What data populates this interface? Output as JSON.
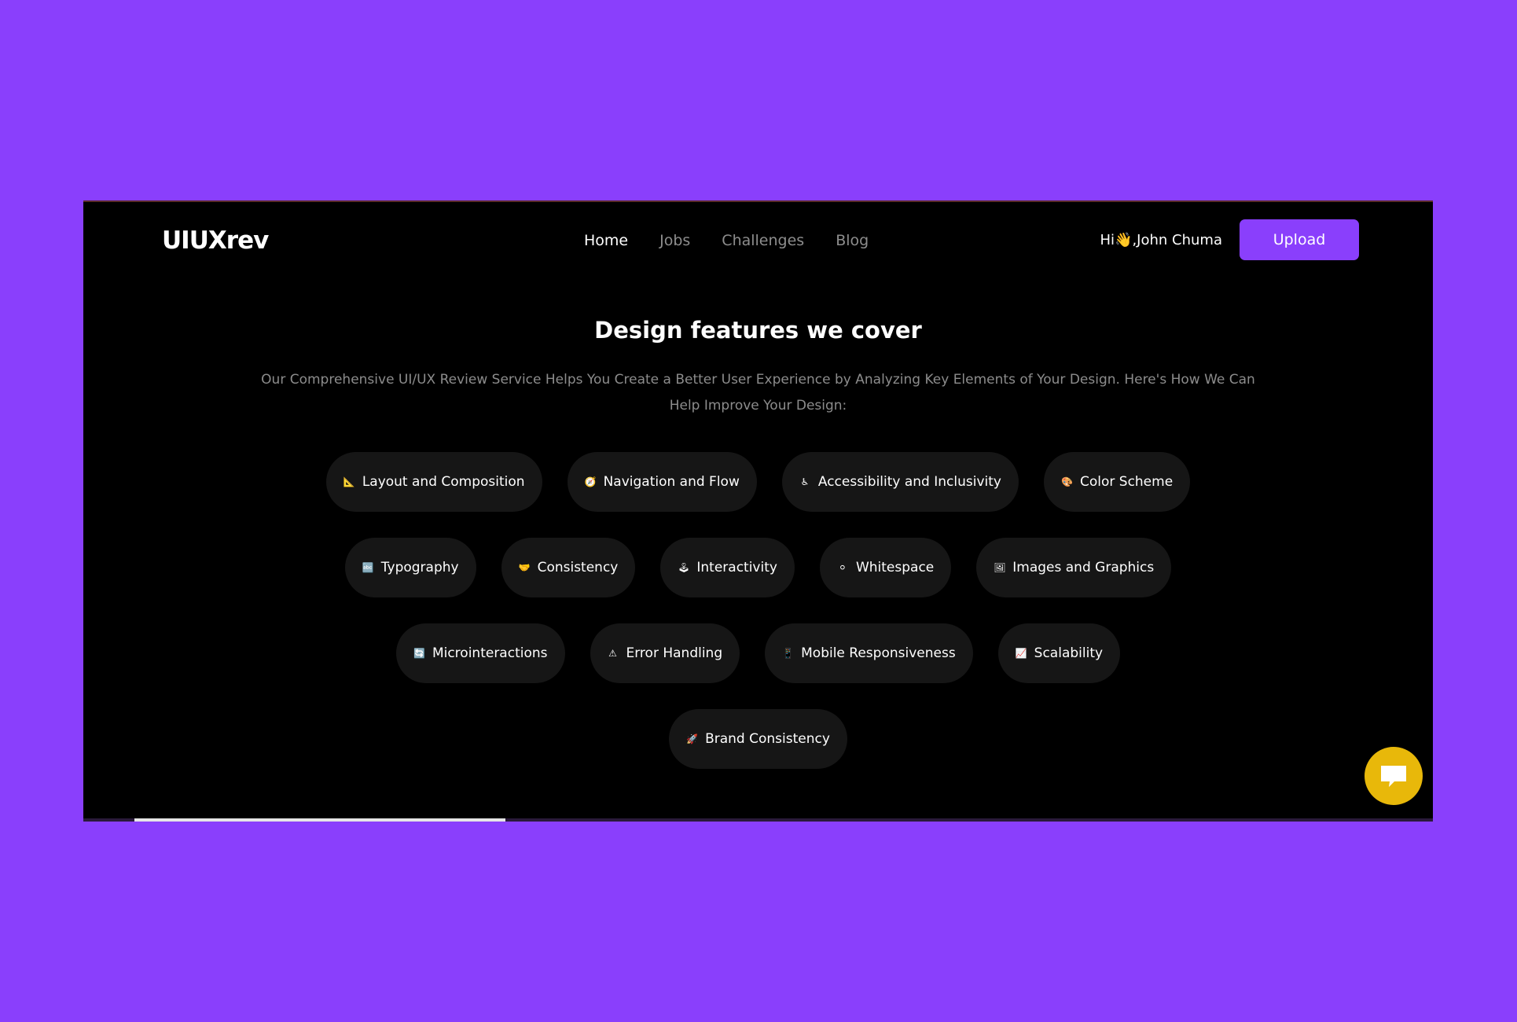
{
  "header": {
    "logo": "UIUXrev",
    "nav": [
      {
        "label": "Home",
        "active": true
      },
      {
        "label": "Jobs",
        "active": false
      },
      {
        "label": "Challenges",
        "active": false
      },
      {
        "label": "Blog",
        "active": false
      }
    ],
    "greeting": "Hi👋,John Chuma",
    "upload_label": "Upload"
  },
  "main": {
    "title": "Design features we cover",
    "subtitle": "Our Comprehensive UI/UX Review Service Helps You Create a Better User Experience by Analyzing Key Elements of Your Design. Here's How We Can Help Improve Your Design:",
    "features": [
      [
        {
          "icon": "📐",
          "icon_name": "triangular-ruler-icon",
          "label": "Layout and Composition"
        },
        {
          "icon": "🧭",
          "icon_name": "compass-icon",
          "label": "Navigation and Flow"
        },
        {
          "icon": "♿",
          "icon_name": "accessibility-icon",
          "label": "Accessibility and Inclusivity"
        },
        {
          "icon": "🎨",
          "icon_name": "palette-icon",
          "label": "Color Scheme"
        }
      ],
      [
        {
          "icon": "🔤",
          "icon_name": "letters-icon",
          "label": "Typography"
        },
        {
          "icon": "🤝",
          "icon_name": "handshake-icon",
          "label": "Consistency"
        },
        {
          "icon": "🕹",
          "icon_name": "joystick-icon",
          "label": "Interactivity"
        },
        {
          "icon": "⚪",
          "icon_name": "white-circle-icon",
          "label": "Whitespace"
        },
        {
          "icon": "🖼",
          "icon_name": "framed-picture-icon",
          "label": "Images and Graphics"
        }
      ],
      [
        {
          "icon": "🔄",
          "icon_name": "cycle-arrows-icon",
          "label": "Microinteractions"
        },
        {
          "icon": "⚠",
          "icon_name": "warning-icon",
          "label": "Error Handling"
        },
        {
          "icon": "📱",
          "icon_name": "mobile-phone-icon",
          "label": "Mobile Responsiveness"
        },
        {
          "icon": "📈",
          "icon_name": "chart-increasing-icon",
          "label": "Scalability"
        }
      ],
      [
        {
          "icon": "🚀",
          "icon_name": "rocket-icon",
          "label": "Brand Consistency"
        }
      ]
    ]
  },
  "progress": {
    "value": 0.25
  },
  "colors": {
    "accent": "#8a3ffc",
    "chat_button": "#e8b80a",
    "chip_bg": "#161616"
  }
}
